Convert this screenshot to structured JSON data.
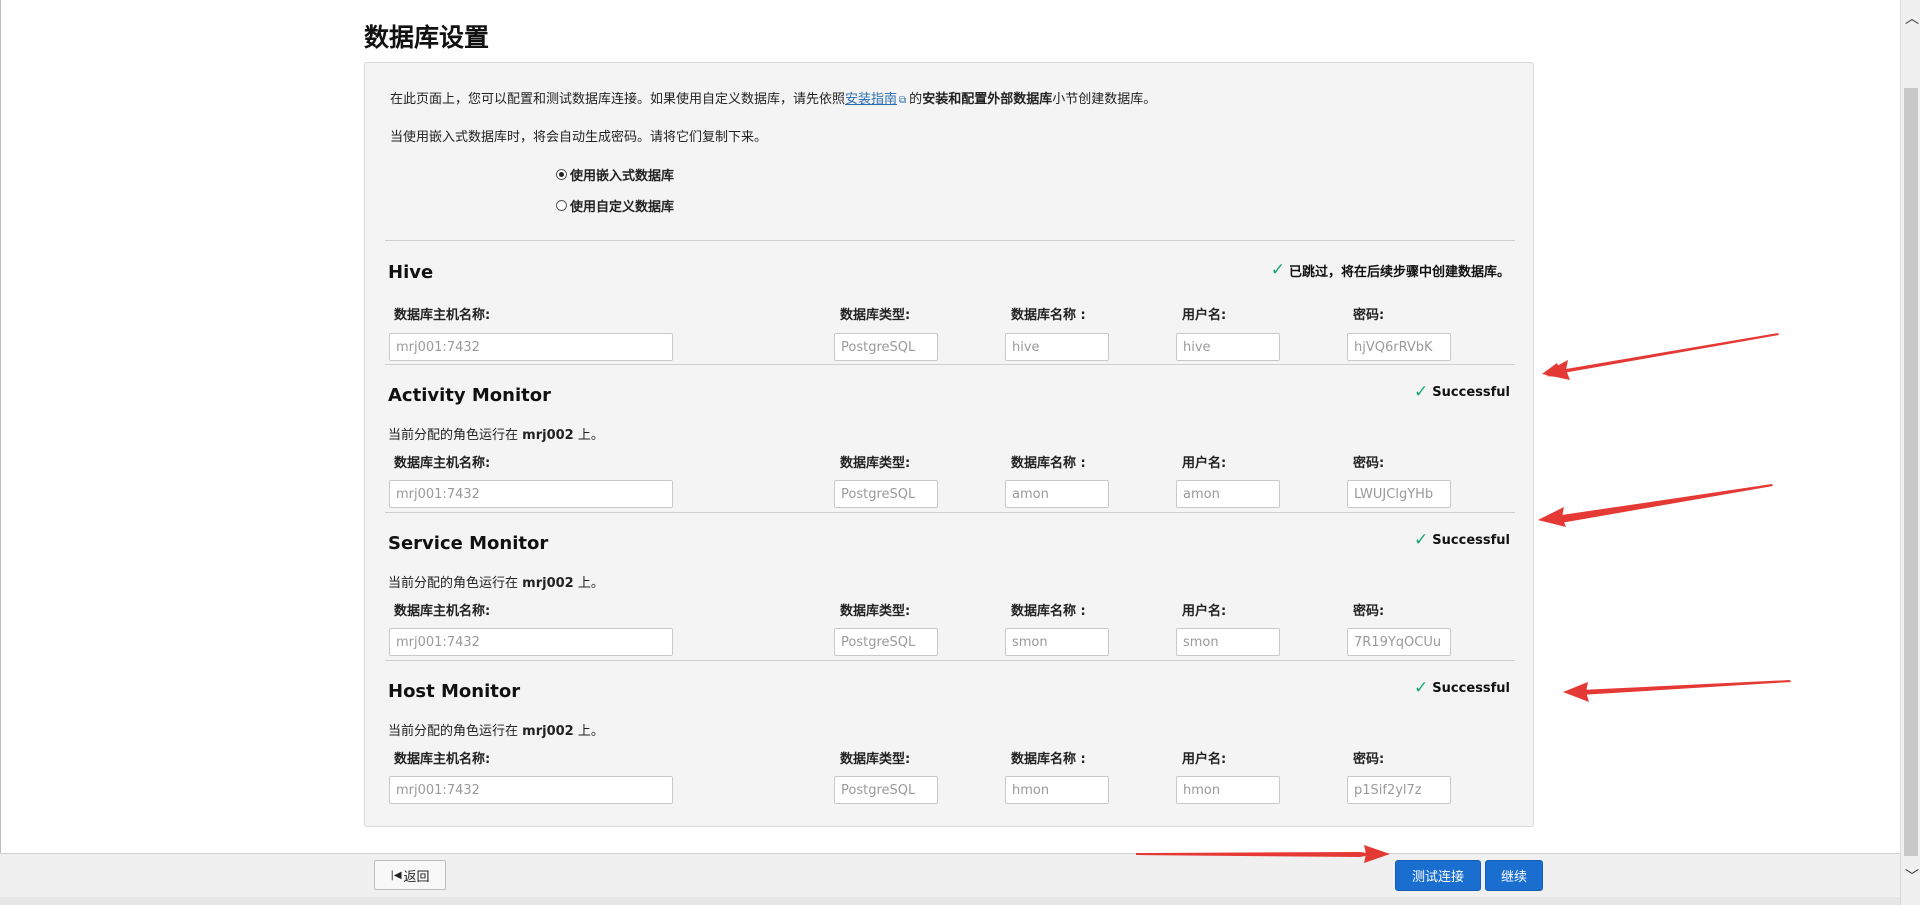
{
  "page_title": "数据库设置",
  "intro": {
    "text_before": "在此页面上，您可以配置和测试数据库连接。如果使用自定义数据库，请先依照",
    "link": "安装指南",
    "text_mid": "的",
    "bold": "安装和配置外部数据库",
    "text_after": "小节创建数据库。"
  },
  "intro2": "当使用嵌入式数据库时，将会自动生成密码。请将它们复制下来。",
  "radio_embedded": "使用嵌入式数据库",
  "radio_custom": "使用自定义数据库",
  "labels": {
    "host": "数据库主机名称:",
    "type": "数据库类型:",
    "dbname": "数据库名称 :",
    "user": "用户名:",
    "password": "密码:"
  },
  "role_prefix": "当前分配的角色运行在",
  "role_suffix": "上。",
  "services": [
    {
      "name": "Hive",
      "status": "已跳过，将在后续步骤中创建数据库。",
      "role_host": "",
      "host": "mrj001:7432",
      "type": "PostgreSQL",
      "dbname": "hive",
      "user": "hive",
      "password": "hjVQ6rRVbK"
    },
    {
      "name": "Activity Monitor",
      "status": "Successful",
      "role_host": "mrj002",
      "host": "mrj001:7432",
      "type": "PostgreSQL",
      "dbname": "amon",
      "user": "amon",
      "password": "LWUJClgYHb"
    },
    {
      "name": "Service Monitor",
      "status": "Successful",
      "role_host": "mrj002",
      "host": "mrj001:7432",
      "type": "PostgreSQL",
      "dbname": "smon",
      "user": "smon",
      "password": "7R19YqOCUu"
    },
    {
      "name": "Host Monitor",
      "status": "Successful",
      "role_host": "mrj002",
      "host": "mrj001:7432",
      "type": "PostgreSQL",
      "dbname": "hmon",
      "user": "hmon",
      "password": "p1Sif2yl7z"
    }
  ],
  "footer": {
    "back": "返回",
    "test": "测试连接",
    "continue": "继续"
  },
  "colors": {
    "primary": "#1a6ecf",
    "check": "#1aa37a",
    "annotation": "#e53935"
  }
}
